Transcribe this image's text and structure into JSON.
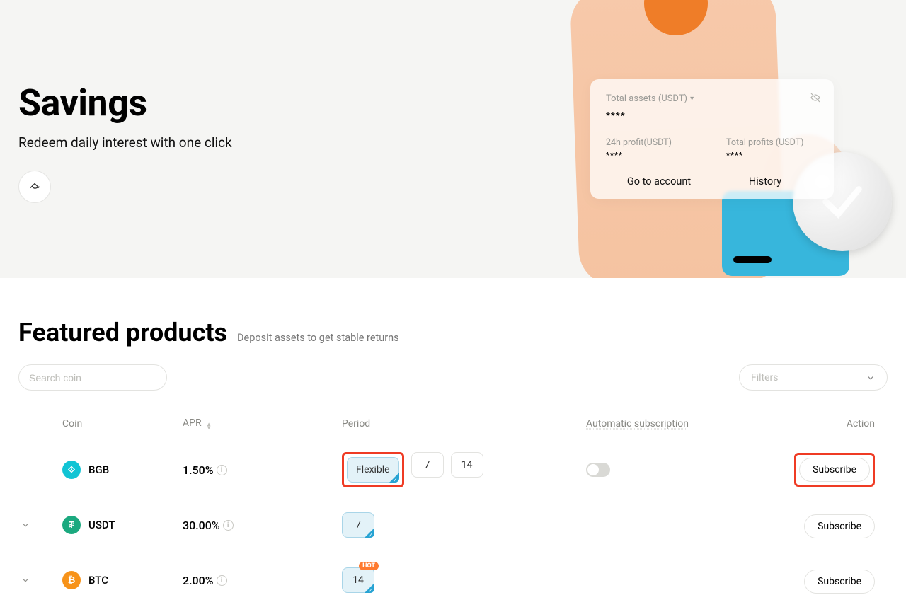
{
  "hero": {
    "title": "Savings",
    "subtitle": "Redeem daily interest with one click"
  },
  "card": {
    "total_assets_label": "Total assets (USDT)",
    "total_assets_value": "****",
    "profit24_label": "24h profit(USDT)",
    "profit24_value": "****",
    "total_profits_label": "Total profits (USDT)",
    "total_profits_value": "****",
    "go_account": "Go to account",
    "history": "History"
  },
  "featured": {
    "title": "Featured products",
    "subtitle": "Deposit assets to get stable returns"
  },
  "search": {
    "placeholder": "Search coin"
  },
  "filters": {
    "label": "Filters"
  },
  "headers": {
    "coin": "Coin",
    "apr": "APR",
    "period": "Period",
    "auto": "Automatic subscription",
    "action": "Action"
  },
  "rows": [
    {
      "symbol": "BGB",
      "apr": "1.50%",
      "icon_bg": "#11c4d4",
      "icon_text": "⟐",
      "periods": [
        {
          "label": "Flexible",
          "selected": true
        },
        {
          "label": "7"
        },
        {
          "label": "14"
        }
      ],
      "show_toggle": true,
      "expandable": false,
      "highlight_period": true,
      "highlight_action": true
    },
    {
      "symbol": "USDT",
      "apr": "30.00%",
      "icon_bg": "#1ba97f",
      "icon_text": "₮",
      "periods": [
        {
          "label": "7",
          "selected": true
        }
      ],
      "show_toggle": false,
      "expandable": true
    },
    {
      "symbol": "BTC",
      "apr": "2.00%",
      "icon_bg": "#f7931a",
      "icon_text": "₿",
      "periods": [
        {
          "label": "14",
          "selected": true,
          "hot": true
        }
      ],
      "show_toggle": false,
      "expandable": true
    }
  ],
  "subscribe": "Subscribe",
  "hot": "HOT"
}
